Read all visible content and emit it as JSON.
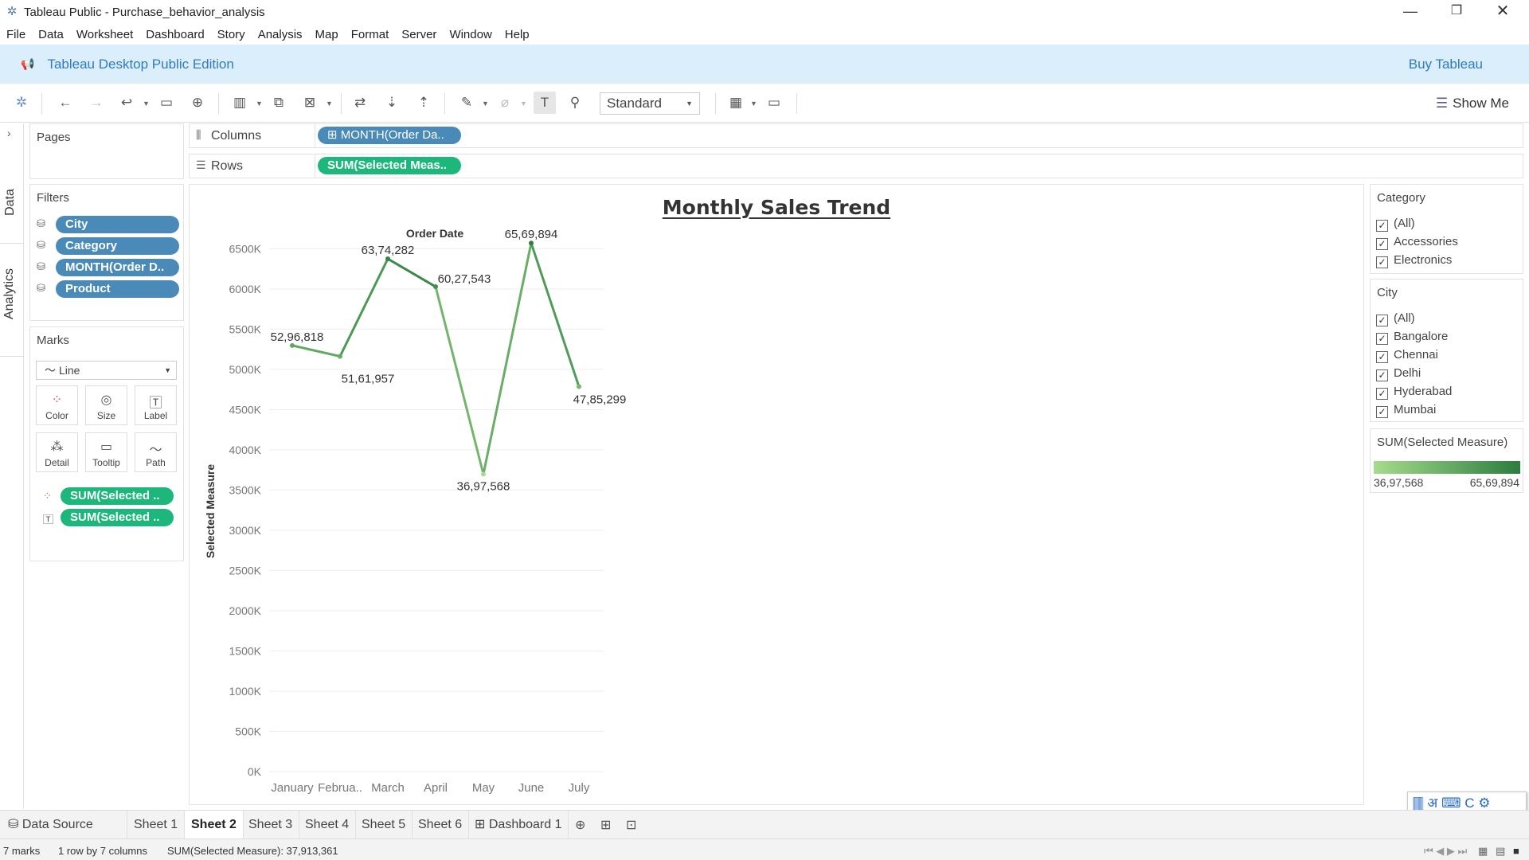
{
  "window": {
    "title": "Tableau Public - Purchase_behavior_analysis",
    "controls": [
      "minimize",
      "restore",
      "close"
    ]
  },
  "menu": [
    "File",
    "Data",
    "Worksheet",
    "Dashboard",
    "Story",
    "Analysis",
    "Map",
    "Format",
    "Server",
    "Window",
    "Help"
  ],
  "banner": {
    "edition": "Tableau Desktop Public Edition",
    "buy": "Buy Tableau"
  },
  "toolbar": {
    "fit_value": "Standard",
    "show_me": "Show Me"
  },
  "side_tabs": {
    "data": "Data",
    "analytics": "Analytics"
  },
  "pages": {
    "title": "Pages"
  },
  "filters": {
    "title": "Filters",
    "items": [
      "City",
      "Category",
      "MONTH(Order D..",
      "Product"
    ]
  },
  "marks": {
    "title": "Marks",
    "type": "Line",
    "buttons": [
      "Color",
      "Size",
      "Label",
      "Detail",
      "Tooltip",
      "Path"
    ],
    "pills": [
      "SUM(Selected ..",
      "SUM(Selected .."
    ]
  },
  "shelves": {
    "columns_label": "Columns",
    "columns_pill": "MONTH(Order Da..",
    "rows_label": "Rows",
    "rows_pill": "SUM(Selected Meas.."
  },
  "category_filter": {
    "title": "Category",
    "options": [
      "(All)",
      "Accessories",
      "Electronics"
    ]
  },
  "city_filter": {
    "title": "City",
    "options": [
      "(All)",
      "Bangalore",
      "Chennai",
      "Delhi",
      "Hyderabad",
      "Mumbai"
    ]
  },
  "color_legend": {
    "title": "SUM(Selected Measure)",
    "min_label": "36,97,568",
    "max_label": "65,69,894",
    "colors": [
      "#a6dc8c",
      "#2b7d40"
    ]
  },
  "chart_data": {
    "type": "line",
    "title": "Monthly Sales Trend",
    "xlabel": "Order Date",
    "ylabel": "Selected Measure",
    "categories": [
      "January",
      "Februa..",
      "March",
      "April",
      "May",
      "June",
      "July"
    ],
    "values": [
      5296818,
      5161957,
      6374282,
      6027543,
      3697568,
      6569894,
      4785299
    ],
    "data_labels": [
      "52,96,818",
      "51,61,957",
      "63,74,282",
      "60,27,543",
      "36,97,568",
      "65,69,894",
      "47,85,299"
    ],
    "ylim": [
      0,
      6800000
    ],
    "yticks": [
      0,
      500000,
      1000000,
      1500000,
      2000000,
      2500000,
      3000000,
      3500000,
      4000000,
      4500000,
      5000000,
      5500000,
      6000000,
      6500000
    ],
    "ytick_labels": [
      "0K",
      "500K",
      "1000K",
      "1500K",
      "2000K",
      "2500K",
      "3000K",
      "3500K",
      "4000K",
      "4500K",
      "5000K",
      "5500K",
      "6000K",
      "6500K"
    ],
    "grid": true,
    "colors": [
      "#a6dc8c",
      "#2b7d40"
    ]
  },
  "sheets": {
    "data_source": "Data Source",
    "tabs": [
      "Sheet 1",
      "Sheet 2",
      "Sheet 3",
      "Sheet 4",
      "Sheet 5",
      "Sheet 6",
      "Dashboard 1"
    ],
    "active": "Sheet 2"
  },
  "status": {
    "marks": "7 marks",
    "dims": "1 row by 7 columns",
    "sum": "SUM(Selected Measure): 37,913,361"
  }
}
